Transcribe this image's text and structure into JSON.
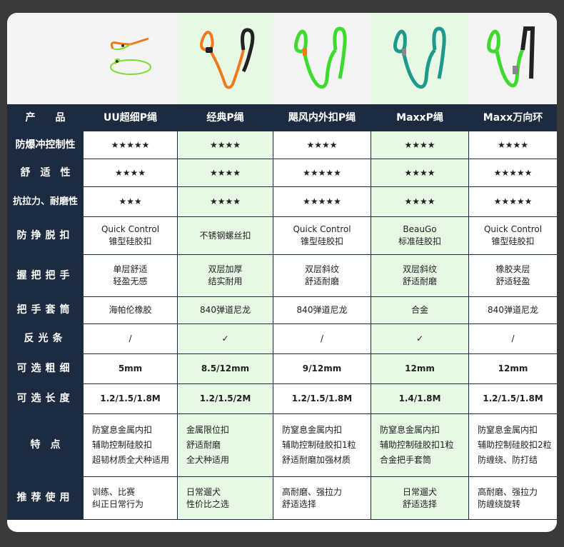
{
  "header": {
    "label": "产　　品",
    "products": [
      "UU超细P绳",
      "经典P绳",
      "飓风内外扣P绳",
      "MaxxP绳",
      "Maxx万向环"
    ]
  },
  "colors": {
    "navy": "#1c2b3f",
    "star": "#f07a1a",
    "highlight": "#e7f8e5",
    "leash_colors": [
      "#7be02a",
      "#f07a1a",
      "#3ddb2e",
      "#1e9a8a",
      "#3ddb2e"
    ]
  },
  "images": [
    "uu-thin-leash",
    "classic-p-leash",
    "hurricane-leash",
    "maxx-p-leash",
    "maxx-swivel-leash"
  ],
  "rows": [
    {
      "label": "防爆冲控制性",
      "cells": [
        "★★★★★",
        "★★★★",
        "★★★★",
        "★★★★",
        "★★★★"
      ]
    },
    {
      "label": "舒　适　性",
      "cells": [
        "★★★★",
        "★★★★",
        "★★★★★",
        "★★★★",
        "★★★★★"
      ]
    },
    {
      "label": "抗拉力、耐磨性",
      "cells": [
        "★★★",
        "★★★★",
        "★★★★★",
        "★★★★",
        "★★★★★"
      ]
    },
    {
      "label": "防挣脱扣",
      "cells": [
        [
          "Quick Control",
          "锥型硅胶扣"
        ],
        [
          "不锈钢螺丝扣"
        ],
        [
          "Quick Control",
          "锥型硅胶扣"
        ],
        [
          "BeauGo",
          "标准硅胶扣"
        ],
        [
          "Quick Control",
          "锥型硅胶扣"
        ]
      ]
    },
    {
      "label": "握把把手",
      "cells": [
        [
          "单层舒适",
          "轻盈无感"
        ],
        [
          "双层加厚",
          "结实耐用"
        ],
        [
          "双层斜纹",
          "舒适耐磨"
        ],
        [
          "双层斜纹",
          "舒适耐磨"
        ],
        [
          "橡胶夹层",
          "舒适轻盈"
        ]
      ]
    },
    {
      "label": "把手套筒",
      "cells": [
        "海帕伦橡胶",
        "840弹道尼龙",
        "840弹道尼龙",
        "合金",
        "840弹道尼龙"
      ]
    },
    {
      "label": "反光条",
      "cells": [
        "/",
        "✓",
        "/",
        "✓",
        "/"
      ]
    },
    {
      "label": "可选粗细",
      "cells": [
        "5mm",
        "8.5/12mm",
        "9/12mm",
        "12mm",
        "12mm"
      ]
    },
    {
      "label": "可选长度",
      "cells": [
        "1.2/1.5/1.8M",
        "1.2/1.5/2M",
        "1.2/1.5/1.8M",
        "1.4/1.8M",
        "1.2/1.5/1.8M"
      ]
    },
    {
      "label": "特　点",
      "cells": [
        [
          "防窒息金属内扣",
          "辅助控制硅胶扣",
          "超韧材质全犬种适用"
        ],
        [
          "金属限位扣",
          "舒适耐磨",
          "全犬种适用"
        ],
        [
          "防窒息金属内扣",
          "辅助控制硅胶扣1粒",
          "舒适耐磨加强材质"
        ],
        [
          "防窒息金属内扣",
          "辅助控制硅胶扣1粒",
          "合金把手套筒"
        ],
        [
          "防窒息金属内扣",
          "辅助控制硅胶扣2粒",
          "防缠绕、防打结"
        ]
      ]
    },
    {
      "label": "推荐使用",
      "cells": [
        [
          "训练、比赛",
          "纠正日常行为"
        ],
        [
          "日常遛犬",
          "性价比之选"
        ],
        [
          "高耐磨、强拉力",
          "舒适选择"
        ],
        [
          "日常遛犬",
          "舒适选择"
        ],
        [
          "高耐磨、强拉力",
          "防缠绕旋转"
        ]
      ]
    }
  ]
}
